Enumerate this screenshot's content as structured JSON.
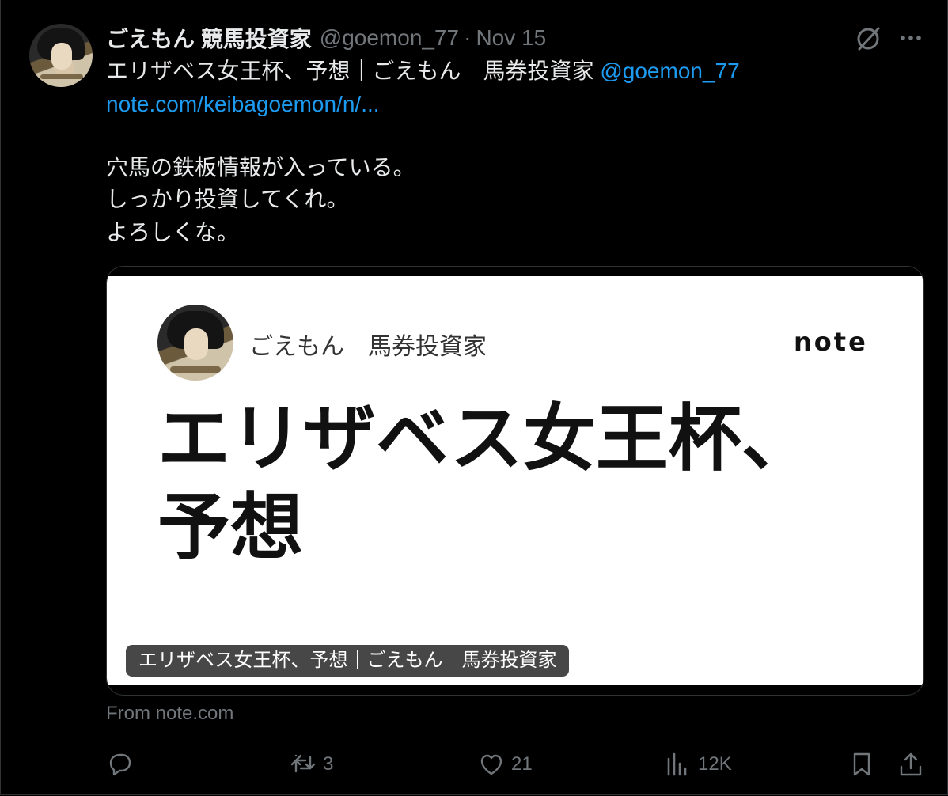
{
  "author": {
    "display_name": "ごえもん 競馬投資家",
    "handle": "@goemon_77",
    "separator": "·",
    "date": "Nov 15"
  },
  "tweet": {
    "line1_text": "エリザベス女王杯、予想｜ごえもん　馬券投資家",
    "line1_mention": "@goemon_77",
    "link_text": "note.com/keibagoemon/n/...",
    "body_lines": [
      "穴馬の鉄板情報が入っている。",
      "しっかり投資してくれ。",
      "よろしくな。"
    ]
  },
  "card": {
    "author": "ごえもん　馬券投資家",
    "logo": "note",
    "title_line1": "エリザベス女王杯、",
    "title_line2": "予想",
    "caption": "エリザベス女王杯、予想｜ごえもん　馬券投資家",
    "source": "From note.com"
  },
  "actions": {
    "reply_count": "",
    "retweet_count": "3",
    "like_count": "21",
    "view_count": "12K"
  },
  "colors": {
    "background": "#000000",
    "text": "#e7e9ea",
    "muted": "#71767b",
    "link": "#1d9bf0"
  }
}
